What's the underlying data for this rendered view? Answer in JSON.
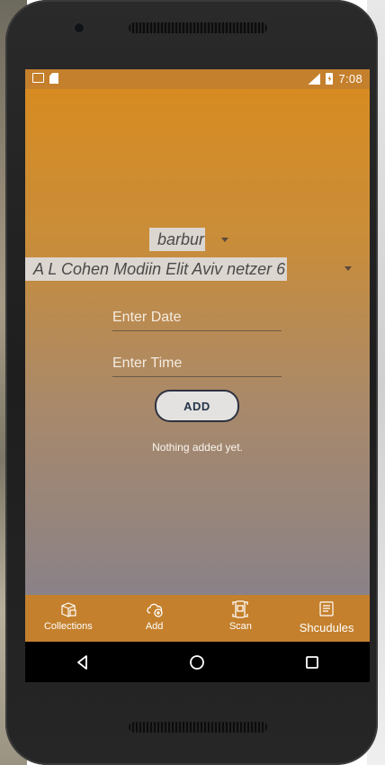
{
  "status_bar": {
    "time": "7:08",
    "icons": [
      "gmail-icon",
      "sim-card-icon",
      "lte-signal-icon",
      "battery-charging-icon"
    ]
  },
  "form": {
    "user_spinner_value": "barbur",
    "address_spinner_value": "A L Cohen Modiin Elit Aviv netzer 6",
    "date_placeholder": "Enter Date",
    "time_placeholder": "Enter Time",
    "add_label": "ADD",
    "empty_message": "Nothing added yet."
  },
  "bottom_nav": {
    "items": [
      {
        "label": "Collections",
        "icon": "package-icon"
      },
      {
        "label": "Add",
        "icon": "cloud-add-icon"
      },
      {
        "label": "Scan",
        "icon": "scan-icon"
      },
      {
        "label": "Shcudules",
        "icon": "schedule-icon"
      }
    ]
  },
  "colors": {
    "accent": "#c4802c",
    "gradient_top": "#d78b21",
    "gradient_bottom": "#8a8288"
  }
}
